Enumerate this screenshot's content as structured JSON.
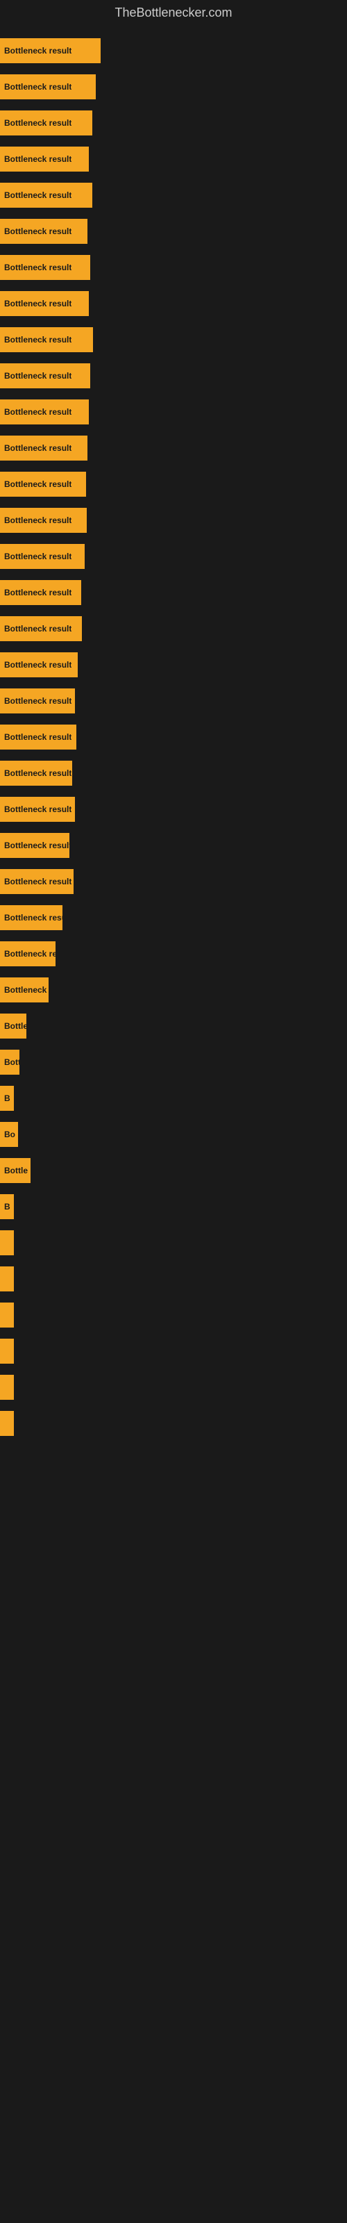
{
  "site": {
    "title": "TheBottlenecker.com"
  },
  "bars": [
    {
      "label": "Bottleneck result",
      "width": 145
    },
    {
      "label": "Bottleneck result",
      "width": 138
    },
    {
      "label": "Bottleneck result",
      "width": 133
    },
    {
      "label": "Bottleneck result",
      "width": 128
    },
    {
      "label": "Bottleneck result",
      "width": 133
    },
    {
      "label": "Bottleneck result",
      "width": 126
    },
    {
      "label": "Bottleneck result",
      "width": 130
    },
    {
      "label": "Bottleneck result",
      "width": 128
    },
    {
      "label": "Bottleneck result",
      "width": 134
    },
    {
      "label": "Bottleneck result",
      "width": 130
    },
    {
      "label": "Bottleneck result",
      "width": 128
    },
    {
      "label": "Bottleneck result",
      "width": 126
    },
    {
      "label": "Bottleneck result",
      "width": 124
    },
    {
      "label": "Bottleneck result",
      "width": 125
    },
    {
      "label": "Bottleneck result",
      "width": 122
    },
    {
      "label": "Bottleneck result",
      "width": 117
    },
    {
      "label": "Bottleneck result",
      "width": 118
    },
    {
      "label": "Bottleneck result",
      "width": 112
    },
    {
      "label": "Bottleneck result",
      "width": 108
    },
    {
      "label": "Bottleneck result",
      "width": 110
    },
    {
      "label": "Bottleneck result",
      "width": 104
    },
    {
      "label": "Bottleneck result",
      "width": 108
    },
    {
      "label": "Bottleneck result",
      "width": 100
    },
    {
      "label": "Bottleneck result",
      "width": 106
    },
    {
      "label": "Bottleneck result",
      "width": 90
    },
    {
      "label": "Bottleneck result",
      "width": 80
    },
    {
      "label": "Bottleneck result",
      "width": 70
    },
    {
      "label": "Bottleneck result",
      "width": 38
    },
    {
      "label": "Bottleneck result",
      "width": 28
    },
    {
      "label": "B",
      "width": 20
    },
    {
      "label": "Bo",
      "width": 26
    },
    {
      "label": "Bottle",
      "width": 44
    },
    {
      "label": "B",
      "width": 18
    },
    {
      "label": "",
      "width": 10
    },
    {
      "label": "",
      "width": 10
    },
    {
      "label": "",
      "width": 10
    },
    {
      "label": "",
      "width": 10
    },
    {
      "label": "",
      "width": 10
    },
    {
      "label": "",
      "width": 8
    }
  ]
}
